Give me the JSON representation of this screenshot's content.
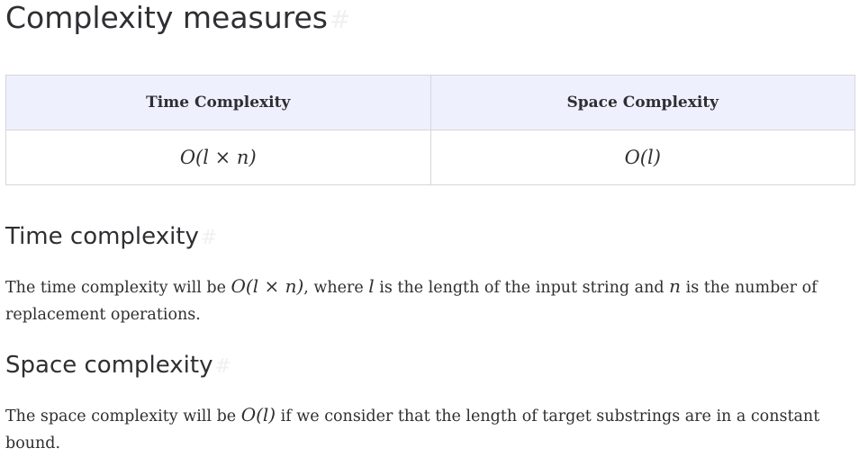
{
  "title": "Complexity measures",
  "anchor_symbol": "#",
  "table": {
    "headers": [
      "Time Complexity",
      "Space Complexity"
    ],
    "row": [
      "O(l × n)",
      "O(l)"
    ]
  },
  "time_section": {
    "heading": "Time complexity",
    "text_before": "The time complexity will be ",
    "expr": "O(l × n)",
    "text_mid1": ", where ",
    "var_l": "l",
    "text_mid2": " is the length of the input string and ",
    "var_n": "n",
    "text_after": " is the number of replacement operations."
  },
  "space_section": {
    "heading": "Space complexity",
    "text_before": "The space complexity will be ",
    "expr": "O(l)",
    "text_after": " if we consider that the length of target substrings are in a constant bound."
  }
}
